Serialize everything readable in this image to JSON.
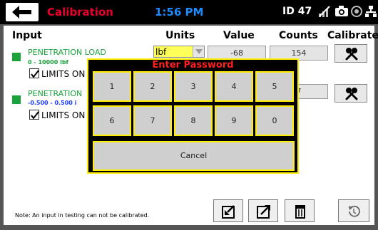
{
  "header": {
    "title": "Calibration",
    "time": "1:56 PM",
    "unit_id": "ID 47",
    "icons": [
      "back-arrow-icon",
      "wifi-off-icon",
      "camera-icon",
      "status-circle-icon",
      "network-icon"
    ]
  },
  "columns": {
    "input": "Input",
    "units": "Units",
    "value": "Value",
    "counts": "Counts",
    "calibrate": "Calibrate"
  },
  "channels": [
    {
      "name": "PENETRATION LOAD",
      "range": "0 - 10000 lbf",
      "range_color": "#1aa23b",
      "units": "lbf",
      "value": "-68",
      "counts": "154",
      "limits_label": "LIMITS ON",
      "limits_checked": true
    },
    {
      "name": "PENETRATION",
      "range": "-0.500 - 0.500 i",
      "range_color": "#1b3cff",
      "counts": "7",
      "limits_label": "LIMITS ON",
      "limits_checked": true
    }
  ],
  "dialog": {
    "title": "Enter Password",
    "keys_row1": [
      "1",
      "2",
      "3",
      "4",
      "5"
    ],
    "keys_row2": [
      "6",
      "7",
      "8",
      "9",
      "0"
    ],
    "cancel": "Cancel"
  },
  "footer": {
    "note": "Note:  An input in testing can not be calibrated.",
    "buttons": [
      "import-icon",
      "export-icon",
      "delete-icon",
      "reset-icon"
    ]
  },
  "colors": {
    "accent_red": "#e8002a",
    "time_blue": "#1b8cff",
    "channel_green": "#1aa23b",
    "dialog_border": "#ffee00",
    "units_highlight": "#ffff5a"
  }
}
